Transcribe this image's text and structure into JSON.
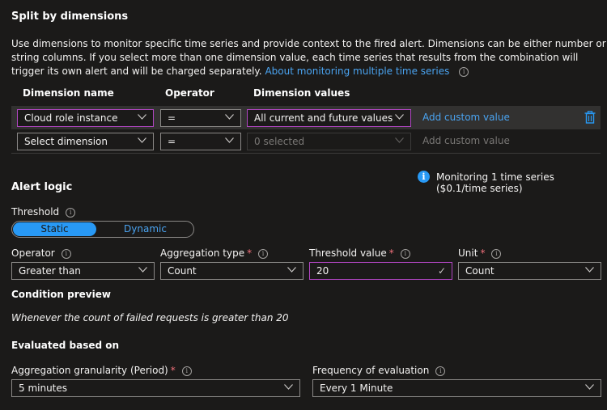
{
  "split": {
    "title": "Split by dimensions",
    "description": "Use dimensions to monitor specific time series and provide context to the fired alert. Dimensions can be either number or string columns. If you select more than one dimension value, each time series that results from the combination will trigger its own alert and will be charged separately.",
    "link": "About monitoring multiple time series",
    "columns": [
      "Dimension name",
      "Operator",
      "Dimension values"
    ],
    "rows": [
      {
        "dimension": "Cloud role instance",
        "operator": "=",
        "values": "All current and future values",
        "custom": "Add custom value"
      },
      {
        "dimension": "Select dimension",
        "operator": "=",
        "values": "0 selected",
        "custom": "Add custom value"
      }
    ],
    "monitoring_info": "Monitoring 1 time series ($0.1/time series)"
  },
  "alert_logic": {
    "title": "Alert logic",
    "threshold_label": "Threshold",
    "threshold_options": [
      "Static",
      "Dynamic"
    ],
    "threshold_selected": "Static",
    "operator_label": "Operator",
    "operator_value": "Greater than",
    "aggregation_label": "Aggregation type",
    "aggregation_value": "Count",
    "threshold_value_label": "Threshold value",
    "threshold_value": "20",
    "unit_label": "Unit",
    "unit_value": "Count",
    "required_mark": "*",
    "preview_title": "Condition preview",
    "preview_text": "Whenever the count of failed requests is greater than 20"
  },
  "evaluation": {
    "title": "Evaluated based on",
    "granularity_label": "Aggregation granularity (Period)",
    "granularity_value": "5 minutes",
    "frequency_label": "Frequency of evaluation",
    "frequency_value": "Every 1 Minute"
  },
  "icons": {
    "info": "i",
    "check": "✓"
  }
}
